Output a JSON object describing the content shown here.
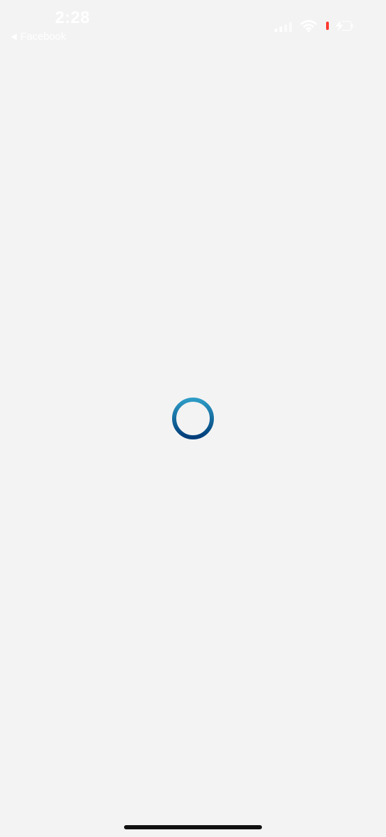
{
  "status_bar": {
    "time": "2:28",
    "back_app": "Facebook"
  },
  "icons": {
    "signal": "signal-icon",
    "wifi": "wifi-icon",
    "battery": "battery-charging-icon",
    "back": "back-arrow-icon",
    "loading": "loading-spinner-icon"
  },
  "colors": {
    "background": "#f3f3f3",
    "spinner_top": "#2d9bc5",
    "spinner_bottom": "#003d7a",
    "battery_alert": "#ff3b30"
  }
}
